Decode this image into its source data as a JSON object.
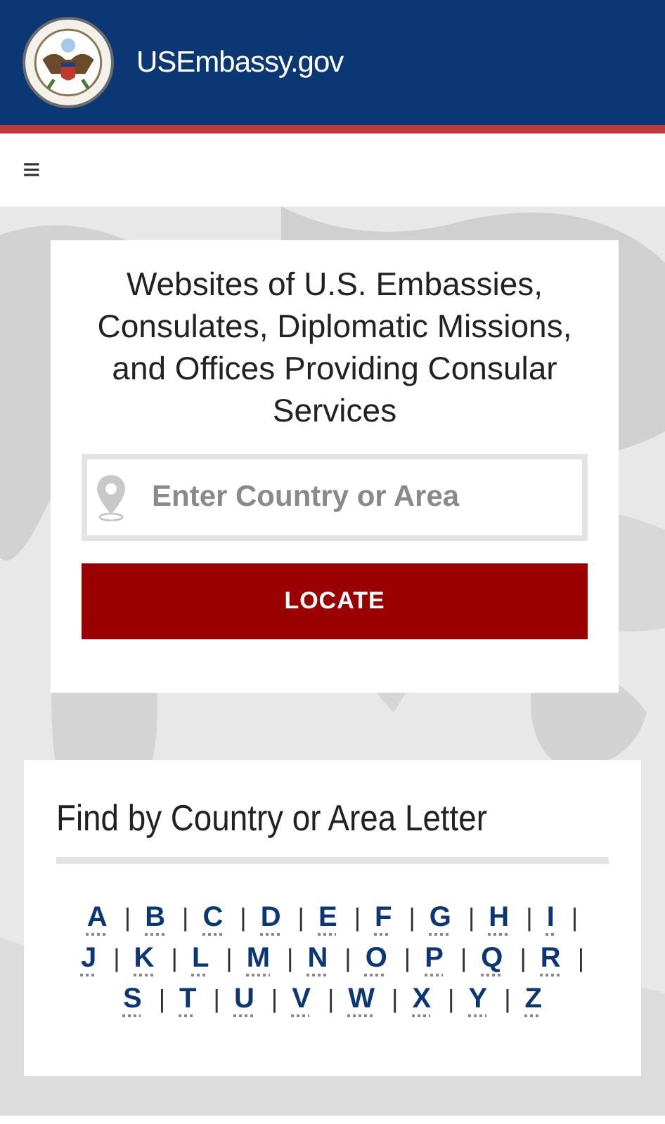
{
  "header": {
    "site_title": "USEmbassy.gov"
  },
  "nav": {
    "menu_glyph": "≡"
  },
  "search_card": {
    "heading": "Websites of U.S. Embassies, Consulates, Diplomatic Missions, and Offices Providing Consular Services",
    "placeholder": "Enter Country or Area",
    "button": "LOCATE"
  },
  "letters_card": {
    "heading": "Find by Country or Area Letter",
    "letters": [
      {
        "letter": "A",
        "separator": "|"
      },
      {
        "letter": "B",
        "separator": "|"
      },
      {
        "letter": "C",
        "separator": "|"
      },
      {
        "letter": "D",
        "separator": "|"
      },
      {
        "letter": "E",
        "separator": "|"
      },
      {
        "letter": "F",
        "separator": "|"
      },
      {
        "letter": "G",
        "separator": "|"
      },
      {
        "letter": "H",
        "separator": "|"
      },
      {
        "letter": "I",
        "separator": "|"
      },
      {
        "letter": "J",
        "separator": "|"
      },
      {
        "letter": "K",
        "separator": "|"
      },
      {
        "letter": "L",
        "separator": "|"
      },
      {
        "letter": "M",
        "separator": "|"
      },
      {
        "letter": "N",
        "separator": "|"
      },
      {
        "letter": "O",
        "separator": "|"
      },
      {
        "letter": "P",
        "separator": "|"
      },
      {
        "letter": "Q",
        "separator": "|"
      },
      {
        "letter": "R",
        "separator": "|"
      },
      {
        "letter": "S",
        "separator": "|"
      },
      {
        "letter": "T",
        "separator": "|"
      },
      {
        "letter": "U",
        "separator": "|"
      },
      {
        "letter": "V",
        "separator": "|"
      },
      {
        "letter": "W",
        "separator": "|"
      },
      {
        "letter": "X",
        "separator": "|"
      },
      {
        "letter": "Y",
        "separator": "|"
      },
      {
        "letter": "Z"
      }
    ]
  }
}
